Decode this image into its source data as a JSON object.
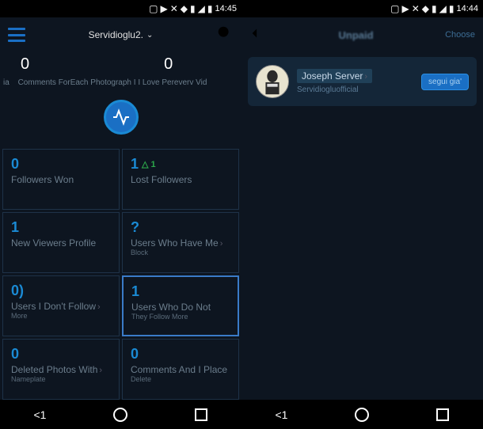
{
  "status": {
    "time_left": "14:45",
    "time_right": "14:44"
  },
  "left": {
    "app_bar": {
      "username": "Servidioglu2."
    },
    "stats": {
      "stat1": "0",
      "stat2": "0"
    },
    "bio_prefix": "ia",
    "bio": "Comments ForEach Photograph I I Love Pereverv Vid",
    "cards": [
      {
        "value": "0",
        "label": "Followers Won",
        "delta": ""
      },
      {
        "value": "1",
        "label": "Lost Followers",
        "delta": "△ 1"
      },
      {
        "value": "1",
        "label": "New Viewers Profile",
        "delta": ""
      },
      {
        "value": "?",
        "label": "Users Who Have Me",
        "sublabel": "Block",
        "arrow": "›"
      },
      {
        "value": "0)",
        "label": "Users I Don't Follow",
        "sublabel": "More",
        "arrow": "›"
      },
      {
        "value": "1",
        "label": "Users Who Do Not",
        "sublabel": "They Follow More",
        "highlight": true
      },
      {
        "value": "0",
        "label": "Deleted Photos With",
        "sublabel": "Nameplate",
        "arrow": "›"
      },
      {
        "value": "0",
        "label": "Comments And I Place",
        "sublabel": "Delete"
      }
    ]
  },
  "right": {
    "app_bar": {
      "title": "Unpaid",
      "choose": "Choose"
    },
    "user": {
      "name": "Joseph Server",
      "handle": "Servidiogluofficial",
      "button": "segui gia'"
    }
  },
  "nav": {
    "back": "<1"
  }
}
